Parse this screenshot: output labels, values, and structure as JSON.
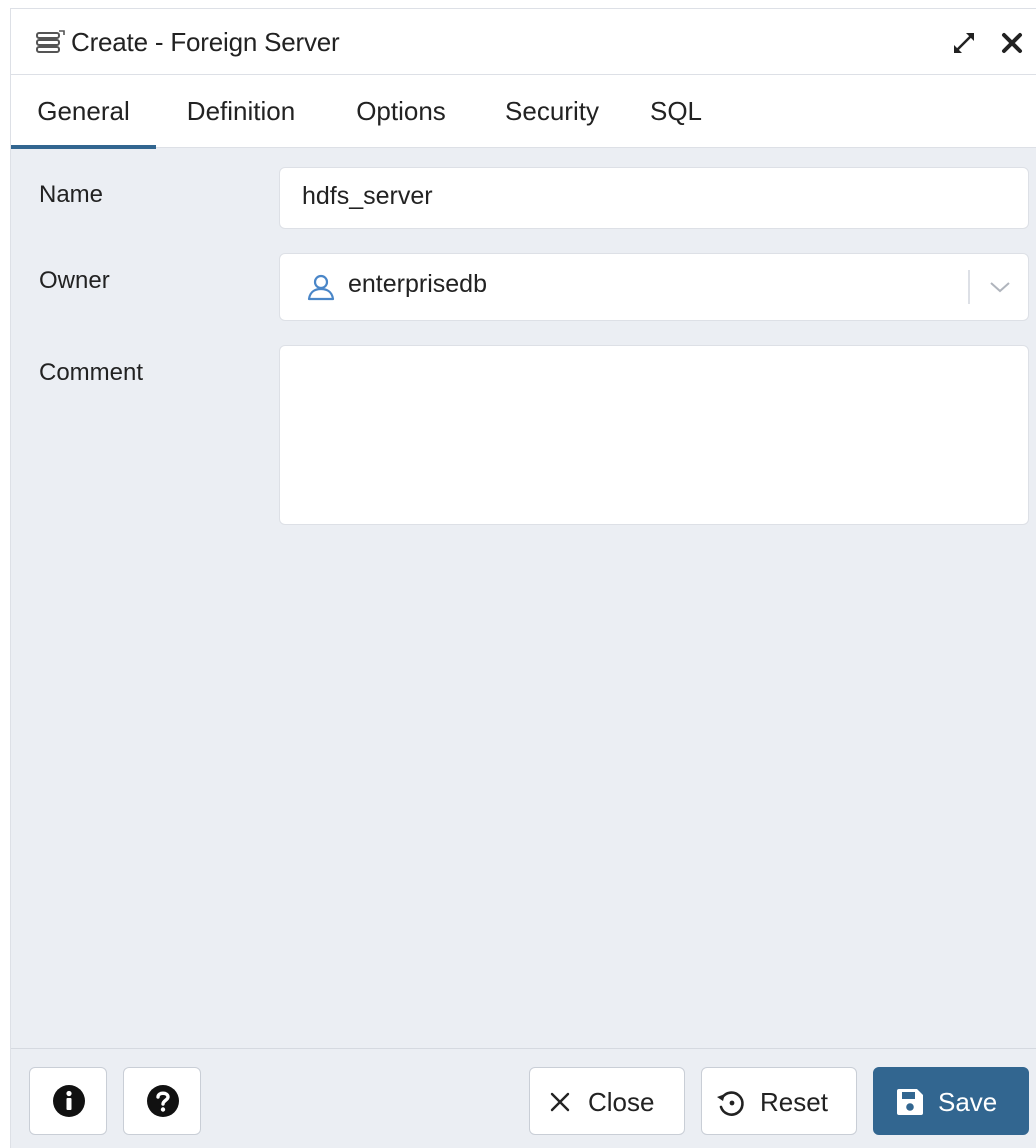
{
  "dialog": {
    "title": "Create - Foreign Server",
    "title_icon": "foreign-server-icon",
    "expand_icon": "expand-icon",
    "close_icon": "close-icon"
  },
  "tabs": [
    {
      "label": "General",
      "active": true
    },
    {
      "label": "Definition",
      "active": false
    },
    {
      "label": "Options",
      "active": false
    },
    {
      "label": "Security",
      "active": false
    },
    {
      "label": "SQL",
      "active": false
    }
  ],
  "form": {
    "name": {
      "label": "Name",
      "value": "hdfs_server"
    },
    "owner": {
      "label": "Owner",
      "value": "enterprisedb",
      "icon": "user-icon"
    },
    "comment": {
      "label": "Comment",
      "value": ""
    }
  },
  "footer": {
    "info_icon": "info-icon",
    "help_icon": "help-icon",
    "close_label": "Close",
    "reset_label": "Reset",
    "save_label": "Save"
  },
  "colors": {
    "accent": "#326690",
    "panel_background": "#ebeef3",
    "border": "#dde0e6",
    "user_icon": "#4a86c8"
  }
}
